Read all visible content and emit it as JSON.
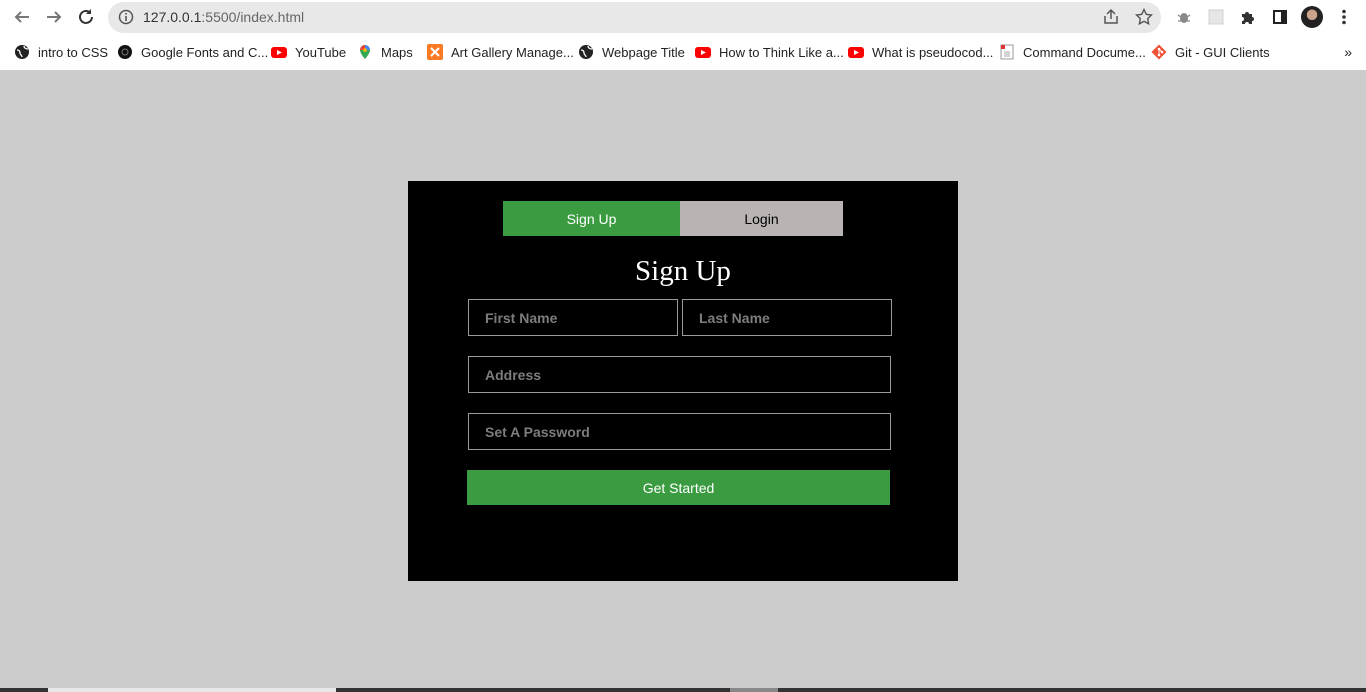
{
  "browser": {
    "url_host": "127.0.0.1",
    "url_path": ":5500/index.html",
    "bookmarks": [
      {
        "label": "intro to CSS",
        "icon": "globe-icon"
      },
      {
        "label": "Google Fonts and C...",
        "icon": "circle-dark-icon"
      },
      {
        "label": "YouTube",
        "icon": "youtube-icon"
      },
      {
        "label": "Maps",
        "icon": "maps-pin-icon"
      },
      {
        "label": "Art Gallery Manage...",
        "icon": "xampp-icon"
      },
      {
        "label": "Webpage Title",
        "icon": "globe-icon"
      },
      {
        "label": "How to Think Like a...",
        "icon": "youtube-icon"
      },
      {
        "label": "What is pseudocod...",
        "icon": "youtube-icon"
      },
      {
        "label": "Command Docume...",
        "icon": "document-icon"
      },
      {
        "label": "Git - GUI Clients",
        "icon": "git-icon"
      }
    ],
    "more_bookmarks": "»"
  },
  "form": {
    "tabs": {
      "signup": "Sign Up",
      "login": "Login"
    },
    "heading": "Sign Up",
    "first_name_placeholder": "First Name",
    "last_name_placeholder": "Last Name",
    "address_placeholder": "Address",
    "password_placeholder": "Set A Password",
    "submit_label": "Get Started"
  },
  "colors": {
    "accent_green": "#3a9b40",
    "login_tab_gray": "#b9b3b3",
    "page_bg": "#cccccc",
    "card_bg": "#000000"
  }
}
